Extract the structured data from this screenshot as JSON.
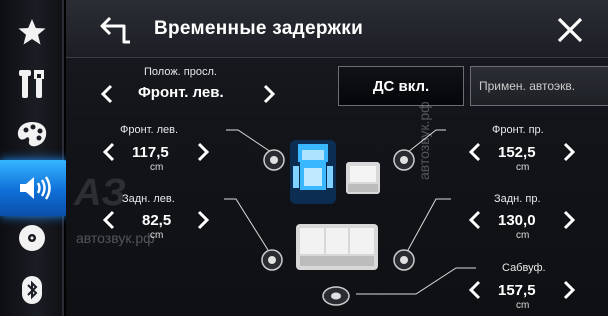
{
  "sidebar": {
    "items": [
      {
        "name": "favorites",
        "icon": "star-icon"
      },
      {
        "name": "settings-tools",
        "icon": "tools-icon"
      },
      {
        "name": "theme",
        "icon": "palette-icon"
      },
      {
        "name": "audio",
        "icon": "speaker-icon",
        "active": true
      },
      {
        "name": "disc",
        "icon": "disc-icon"
      },
      {
        "name": "bluetooth",
        "icon": "bluetooth-icon"
      }
    ]
  },
  "header": {
    "title": "Временные задержки",
    "back_icon": "back-arrow-icon",
    "close_icon": "close-icon"
  },
  "listening_position": {
    "label": "Полож. просл.",
    "value": "Фронт. лев."
  },
  "buttons": {
    "dc": "ДС вкл.",
    "auto_eq": "Примен. автоэкв."
  },
  "speakers": {
    "front_left": {
      "label": "Фронт. лев.",
      "value": "117,5",
      "unit": "cm"
    },
    "front_right": {
      "label": "Фронт. пр.",
      "value": "152,5",
      "unit": "cm"
    },
    "rear_left": {
      "label": "Задн. лев.",
      "value": "82,5",
      "unit": "cm"
    },
    "rear_right": {
      "label": "Задн. пр.",
      "value": "130,0",
      "unit": "cm"
    },
    "subwoofer": {
      "label": "Сабвуф.",
      "value": "157,5",
      "unit": "cm"
    }
  },
  "watermark": {
    "logo": "AЗ",
    "text": "автозвук.рф"
  },
  "colors": {
    "accent": "#1e90ff",
    "selected_seat": "#3ab8ff"
  }
}
